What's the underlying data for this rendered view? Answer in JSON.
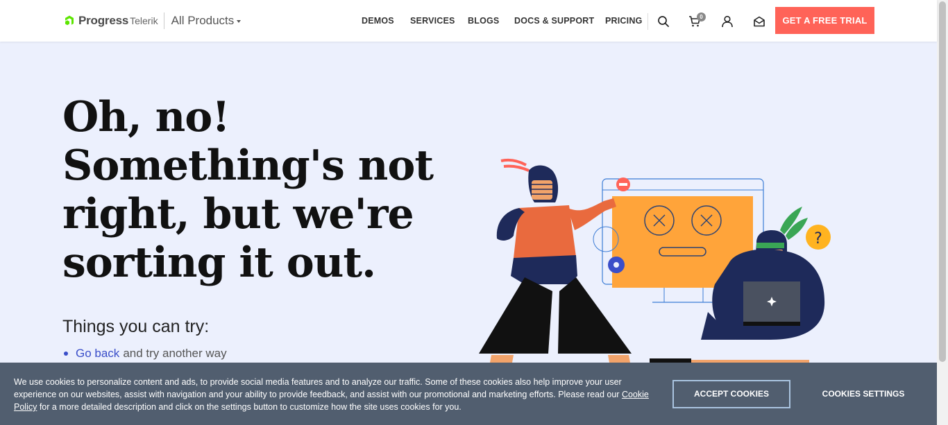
{
  "header": {
    "logo_progress": "Progress",
    "logo_telerik": "Telerik",
    "all_products": "All Products",
    "nav": [
      "DEMOS",
      "SERVICES",
      "BLOGS",
      "DOCS & SUPPORT",
      "PRICING"
    ],
    "cart_count": "0",
    "trial_button": "GET A FREE TRIAL",
    "accent_color": "#ff6358",
    "brand_green": "#5ce500"
  },
  "main": {
    "headline": [
      "Oh, no!",
      "Something's not",
      "right, but we're",
      "sorting it out."
    ],
    "things_title": "Things you can try:",
    "suggestion_link": "Go back",
    "suggestion_text": "and try another way",
    "link_color": "#3a4ec9"
  },
  "cookie": {
    "text_before": "We use cookies to personalize content and ads, to provide social media features and to analyze our traffic. Some of these cookies also help improve your user experience on our websites, assist with navigation and your ability to provide feedback, and assist with our promotional and marketing efforts. Please read our ",
    "link": "Cookie Policy",
    "text_after": " for a more detailed description and click on the settings button to customize how the site uses cookies for you.",
    "accept": "ACCEPT COOKIES",
    "settings": "COOKIES SETTINGS"
  },
  "icons": [
    "progress-logo-icon",
    "search-icon",
    "cart-icon",
    "user-icon",
    "mail-icon",
    "question-icon",
    "sparkle-icon",
    "minus-icon",
    "close-icon",
    "gear-icon"
  ]
}
